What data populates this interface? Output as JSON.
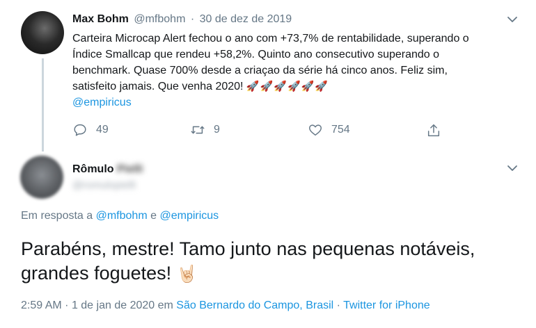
{
  "tweet": {
    "author_name": "Max Bohm",
    "handle": "@mfbohm",
    "separator": "·",
    "date": "30 de dez de 2019",
    "text": "Carteira Microcap Alert fechou o ano com +73,7% de rentabilidade, superando o Índice Smallcap que rendeu +58,2%. Quinto ano consecutivo superando o benchmark. Quase 700% desde a criaçao da série há cinco anos. Feliz sim, satisfeito jamais. Que venha 2020! ",
    "rockets": "🚀🚀🚀🚀🚀🚀",
    "mention": "@empiricus",
    "replies": "49",
    "retweets": "9",
    "likes": "754"
  },
  "reply": {
    "author_name": "Rômulo",
    "author_name_hidden": "Pielli",
    "handle_hidden": "@romulopielli",
    "reply_prefix": "Em resposta a",
    "reply_to_1": "@mfbohm",
    "reply_conj": "e",
    "reply_to_2": "@empiricus",
    "text": "Parabéns, mestre! Tamo junto nas pequenas notáveis, grandes foguetes!",
    "emoji": "🤘🏻",
    "time": "2:59 AM",
    "dot": "·",
    "date": "1 de jan de 2020",
    "in_word": "em",
    "location": "São Bernardo do Campo, Brasil",
    "dot2": "·",
    "source": "Twitter for iPhone"
  },
  "colors": {
    "link": "#1b95e0",
    "muted": "#657786",
    "text": "#14171a",
    "thread_line": "#ccd6dd"
  }
}
